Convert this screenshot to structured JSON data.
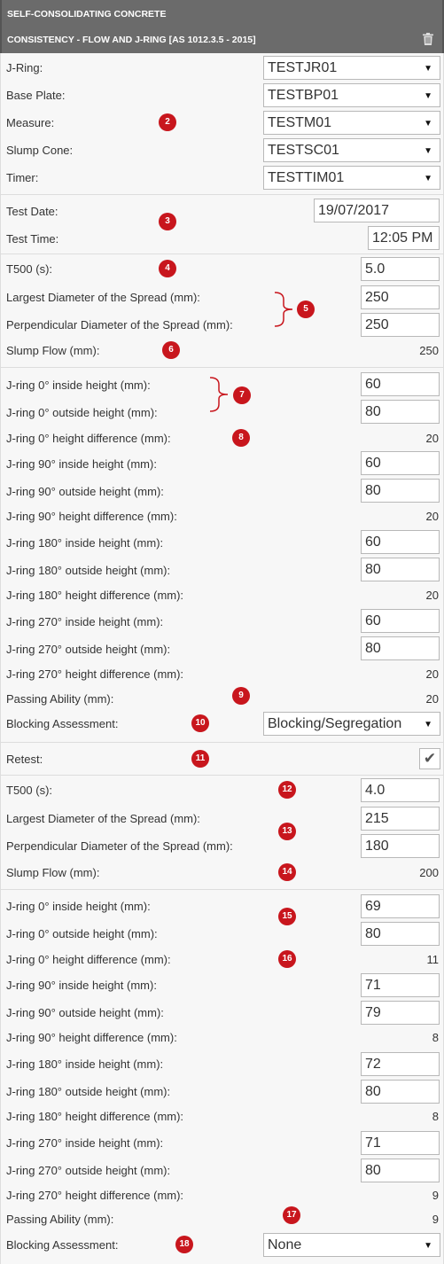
{
  "header": {
    "section_title": "SELF-CONSOLIDATING CONCRETE",
    "test_title": "CONSISTENCY - FLOW AND J-RING [AS 1012.3.5 - 2015]",
    "delete_icon": "trash-icon"
  },
  "equipment": {
    "jring": {
      "label": "J-Ring:",
      "value": "TESTJR01"
    },
    "base_plate": {
      "label": "Base Plate:",
      "value": "TESTBP01"
    },
    "measure": {
      "label": "Measure:",
      "value": "TESTM01"
    },
    "slump_cone": {
      "label": "Slump Cone:",
      "value": "TESTSC01"
    },
    "timer": {
      "label": "Timer:",
      "value": "TESTTIM01"
    }
  },
  "datetime": {
    "date_label": "Test Date:",
    "date_value": "19/07/2017",
    "time_label": "Test Time:",
    "time_value": "12:05 PM"
  },
  "test1": {
    "t500": {
      "label": "T500 (s):",
      "value": "5.0"
    },
    "largest": {
      "label": "Largest Diameter of the Spread (mm):",
      "value": "250"
    },
    "perpendicular": {
      "label": "Perpendicular Diameter of the Spread (mm):",
      "value": "250"
    },
    "slump_flow": {
      "label": "Slump Flow (mm):",
      "value": "250"
    },
    "jr0_in": {
      "label": "J-ring 0° inside height (mm):",
      "value": "60"
    },
    "jr0_out": {
      "label": "J-ring 0° outside height (mm):",
      "value": "80"
    },
    "jr0_diff": {
      "label": "J-ring 0° height difference (mm):",
      "value": "20"
    },
    "jr90_in": {
      "label": "J-ring 90° inside height (mm):",
      "value": "60"
    },
    "jr90_out": {
      "label": "J-ring 90° outside height (mm):",
      "value": "80"
    },
    "jr90_diff": {
      "label": "J-ring 90° height difference (mm):",
      "value": "20"
    },
    "jr180_in": {
      "label": "J-ring 180° inside height (mm):",
      "value": "60"
    },
    "jr180_out": {
      "label": "J-ring 180° outside height (mm):",
      "value": "80"
    },
    "jr180_diff": {
      "label": "J-ring 180° height difference (mm):",
      "value": "20"
    },
    "jr270_in": {
      "label": "J-ring 270° inside height (mm):",
      "value": "60"
    },
    "jr270_out": {
      "label": "J-ring 270° outside height (mm):",
      "value": "80"
    },
    "jr270_diff": {
      "label": "J-ring 270° height difference (mm):",
      "value": "20"
    },
    "passing": {
      "label": "Passing Ability (mm):",
      "value": "20"
    },
    "blocking": {
      "label": "Blocking Assessment:",
      "value": "Blocking/Segregation"
    }
  },
  "retest": {
    "label": "Retest:",
    "checked": true
  },
  "test2": {
    "t500": {
      "label": "T500 (s):",
      "value": "4.0"
    },
    "largest": {
      "label": "Largest Diameter of the Spread (mm):",
      "value": "215"
    },
    "perpendicular": {
      "label": "Perpendicular Diameter of the Spread (mm):",
      "value": "180"
    },
    "slump_flow": {
      "label": "Slump Flow (mm):",
      "value": "200"
    },
    "jr0_in": {
      "label": "J-ring 0° inside height (mm):",
      "value": "69"
    },
    "jr0_out": {
      "label": "J-ring 0° outside height (mm):",
      "value": "80"
    },
    "jr0_diff": {
      "label": "J-ring 0° height difference (mm):",
      "value": "11"
    },
    "jr90_in": {
      "label": "J-ring 90° inside height (mm):",
      "value": "71"
    },
    "jr90_out": {
      "label": "J-ring 90° outside height (mm):",
      "value": "79"
    },
    "jr90_diff": {
      "label": "J-ring 90° height difference (mm):",
      "value": "8"
    },
    "jr180_in": {
      "label": "J-ring 180° inside height (mm):",
      "value": "72"
    },
    "jr180_out": {
      "label": "J-ring 180° outside height (mm):",
      "value": "80"
    },
    "jr180_diff": {
      "label": "J-ring 180° height difference (mm):",
      "value": "8"
    },
    "jr270_in": {
      "label": "J-ring 270° inside height (mm):",
      "value": "71"
    },
    "jr270_out": {
      "label": "J-ring 270° outside height (mm):",
      "value": "80"
    },
    "jr270_diff": {
      "label": "J-ring 270° height difference (mm):",
      "value": "9"
    },
    "passing": {
      "label": "Passing Ability (mm):",
      "value": "9"
    },
    "blocking": {
      "label": "Blocking Assessment:",
      "value": "None"
    }
  },
  "badges": [
    "2",
    "3",
    "4",
    "5",
    "6",
    "7",
    "8",
    "9",
    "10",
    "11",
    "12",
    "13",
    "14",
    "15",
    "16",
    "17",
    "18"
  ],
  "colors": {
    "header_bg": "#6b6b6b",
    "badge": "#c8161d",
    "panel_bg": "#f7f7f7"
  }
}
